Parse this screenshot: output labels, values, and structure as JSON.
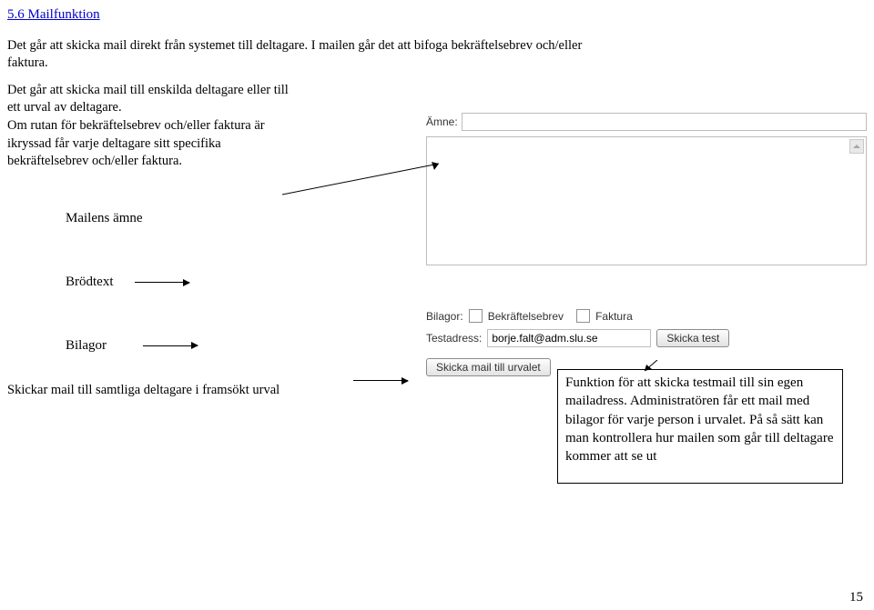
{
  "heading": "5.6 Mailfunktion",
  "intro_p1": "Det går att skicka mail direkt från systemet till deltagare. I mailen går det att bifoga bekräftelsebrev och/eller faktura.",
  "left_block": "Det går att skicka mail till enskilda deltagare eller till ett urval av deltagare.\nOm rutan för bekräftelsebrev och/eller faktura är ikryssad får varje deltagare sitt specifika bekräftelsebrev och/eller faktura.",
  "label_amne_ui": "Ämne:",
  "label_mailens_amne": "Mailens ämne",
  "label_brodtext": "Brödtext",
  "label_bilagor": "Bilagor",
  "bilagor_ui_label": "Bilagor:",
  "bilagor_opt1": "Bekräftelsebrev",
  "bilagor_opt2": "Faktura",
  "testadress_label": "Testadress:",
  "testadress_value": "borje.falt@adm.slu.se",
  "skicka_test_btn": "Skicka test",
  "skicka_urval_btn": "Skicka mail till urvalet",
  "lastline_txt": "Skickar mail till samtliga deltagare i framsökt urval",
  "notebox_text": "Funktion för att skicka testmail till sin egen mailadress. Administratören får ett mail med bilagor för varje person i urvalet. På så sätt kan man kontrollera hur mailen som går till deltagare kommer att se ut",
  "page_number": "15"
}
